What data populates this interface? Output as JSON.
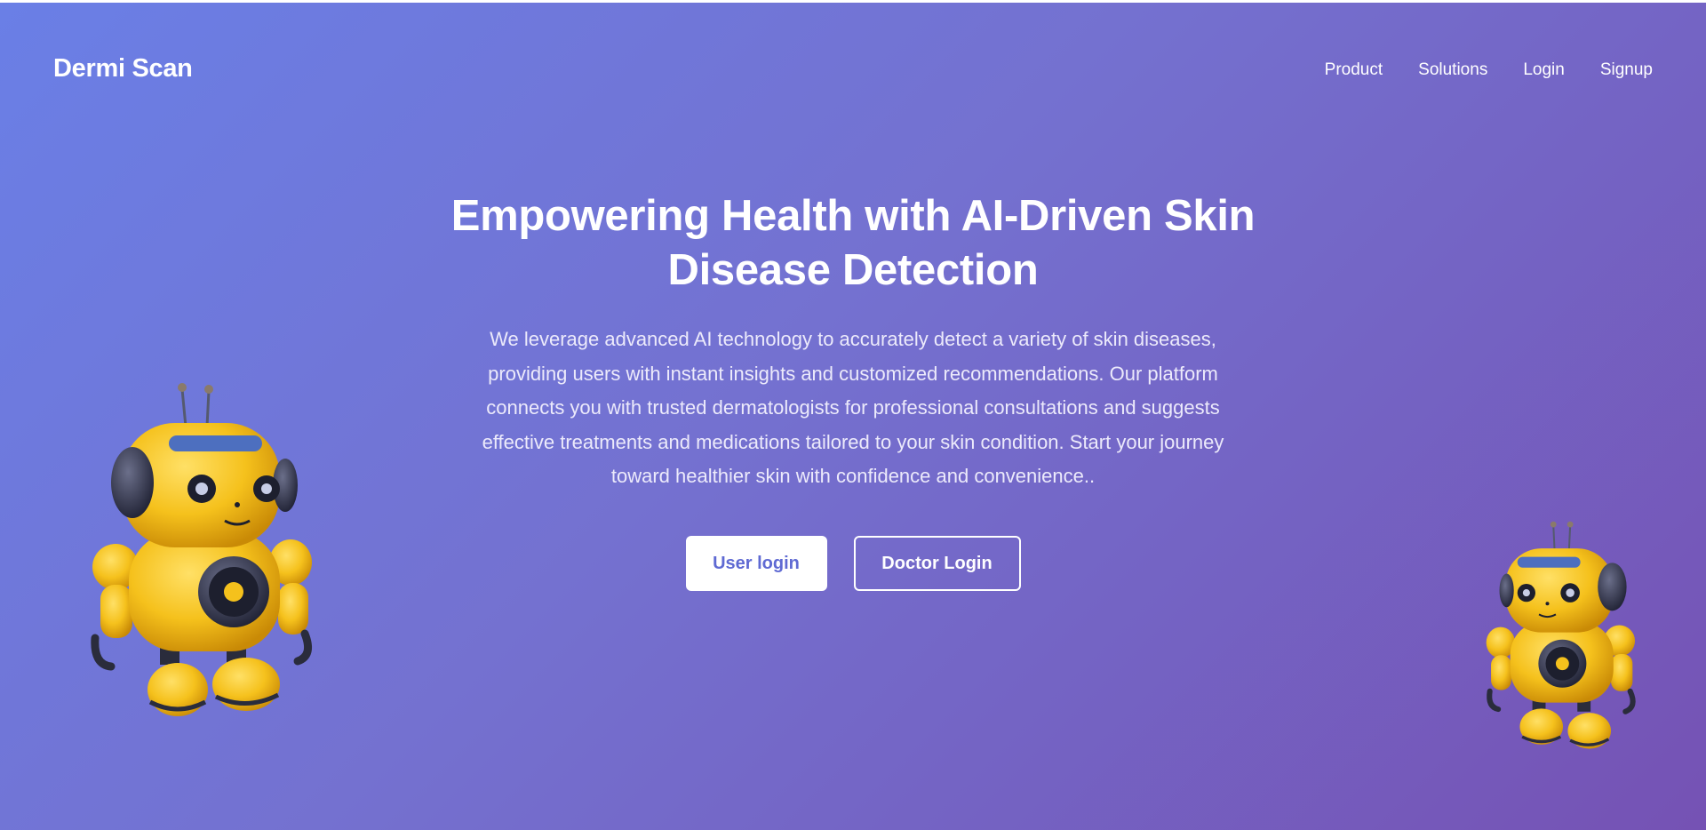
{
  "brand": {
    "name": "Dermi Scan"
  },
  "nav": {
    "items": [
      {
        "label": "Product"
      },
      {
        "label": "Solutions"
      },
      {
        "label": "Login"
      },
      {
        "label": "Signup"
      }
    ]
  },
  "hero": {
    "title": "Empowering Health with AI-Driven Skin Disease Detection",
    "description": "We leverage advanced AI technology to accurately detect a variety of skin diseases, providing users with instant insights and customized recommendations. Our platform connects you with trusted dermatologists for professional consultations and suggests effective treatments and medications tailored to your skin condition. Start your journey toward healthier skin with confidence and convenience..",
    "user_login_label": "User login",
    "doctor_login_label": "Doctor Login"
  },
  "illustrations": {
    "left": "robot-illustration",
    "right": "robot-illustration"
  },
  "colors": {
    "gradient_start": "#6a7fe6",
    "gradient_end": "#7552b4",
    "primary_button_text": "#5f6ad3",
    "robot_yellow": "#f5c11c"
  }
}
